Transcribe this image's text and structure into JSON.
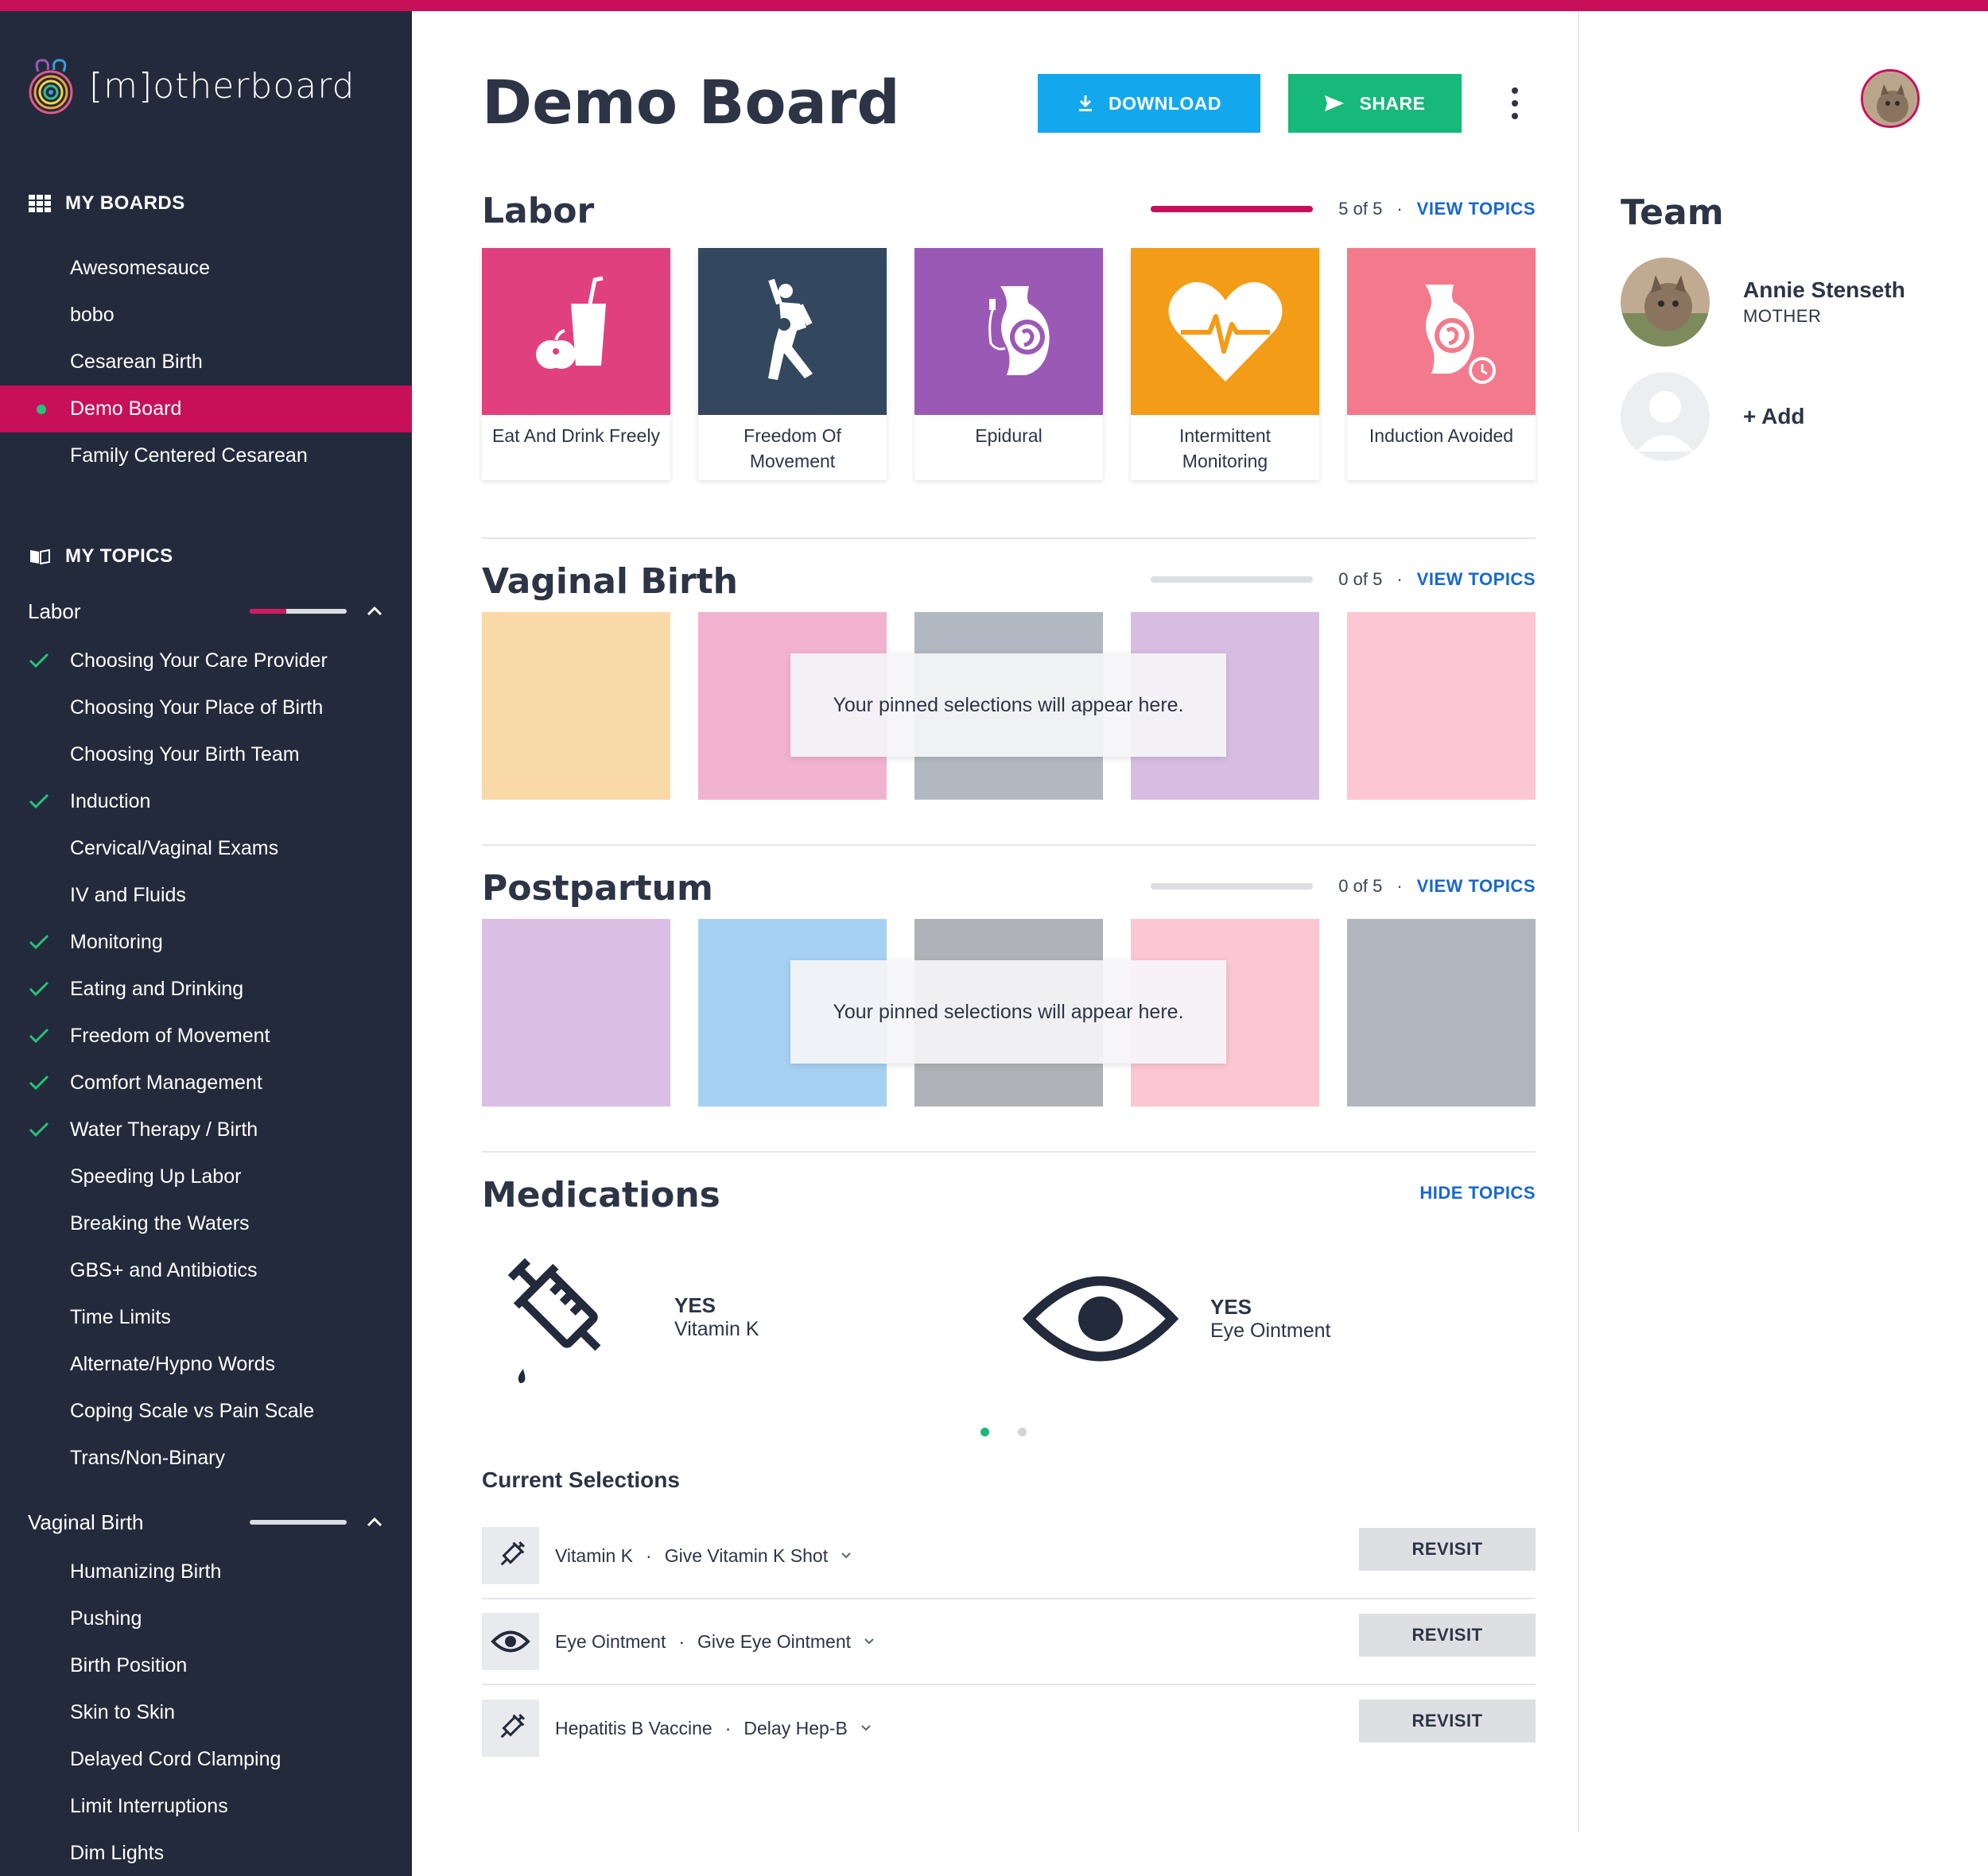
{
  "app": {
    "name": "[m]otherboard"
  },
  "sidebar": {
    "my_boards_label": "MY BOARDS",
    "boards": [
      {
        "label": "Awesomesauce",
        "active": false
      },
      {
        "label": "bobo",
        "active": false
      },
      {
        "label": "Cesarean Birth",
        "active": false
      },
      {
        "label": "Demo Board",
        "active": true
      },
      {
        "label": "Family Centered Cesarean",
        "active": false
      }
    ],
    "my_topics_label": "MY TOPICS",
    "groups": [
      {
        "label": "Labor",
        "progress": 0.38,
        "topics": [
          {
            "label": "Choosing Your Care Provider",
            "checked": true
          },
          {
            "label": "Choosing Your Place of Birth",
            "checked": false
          },
          {
            "label": "Choosing Your Birth Team",
            "checked": false
          },
          {
            "label": "Induction",
            "checked": true
          },
          {
            "label": "Cervical/Vaginal Exams",
            "checked": false
          },
          {
            "label": "IV and Fluids",
            "checked": false
          },
          {
            "label": "Monitoring",
            "checked": true
          },
          {
            "label": "Eating and Drinking",
            "checked": true
          },
          {
            "label": "Freedom of Movement",
            "checked": true
          },
          {
            "label": "Comfort Management",
            "checked": true
          },
          {
            "label": "Water Therapy / Birth",
            "checked": true
          },
          {
            "label": "Speeding Up Labor",
            "checked": false
          },
          {
            "label": "Breaking the Waters",
            "checked": false
          },
          {
            "label": "GBS+ and Antibiotics",
            "checked": false
          },
          {
            "label": "Time Limits",
            "checked": false
          },
          {
            "label": "Alternate/Hypno Words",
            "checked": false
          },
          {
            "label": "Coping Scale vs Pain Scale",
            "checked": false
          },
          {
            "label": "Trans/Non-Binary",
            "checked": false
          }
        ]
      },
      {
        "label": "Vaginal Birth",
        "progress": 0,
        "topics": [
          {
            "label": "Humanizing Birth",
            "checked": false
          },
          {
            "label": "Pushing",
            "checked": false
          },
          {
            "label": "Birth Position",
            "checked": false
          },
          {
            "label": "Skin to Skin",
            "checked": false
          },
          {
            "label": "Delayed Cord Clamping",
            "checked": false
          },
          {
            "label": "Limit Interruptions",
            "checked": false
          },
          {
            "label": "Dim Lights",
            "checked": false
          }
        ]
      }
    ]
  },
  "header": {
    "title": "Demo Board",
    "download_label": "DOWNLOAD",
    "share_label": "SHARE"
  },
  "sections": {
    "labor": {
      "title": "Labor",
      "count": "5 of 5",
      "progress": 1.0,
      "link": "VIEW TOPICS",
      "cards": [
        {
          "label": "Eat And Drink Freely",
          "color": "#e0407e",
          "icon": "drink-food-icon"
        },
        {
          "label": "Freedom Of Movement",
          "color": "#33475e",
          "icon": "movement-figure-icon"
        },
        {
          "label": "Epidural",
          "color": "#9b59b6",
          "icon": "epidural-icon"
        },
        {
          "label": "Intermittent Monitoring",
          "color": "#f39c17",
          "icon": "heart-monitor-icon"
        },
        {
          "label": "Induction Avoided",
          "color": "#f27a8c",
          "icon": "induction-clock-icon"
        }
      ]
    },
    "vaginal": {
      "title": "Vaginal Birth",
      "count": "0 of 5",
      "progress": 0,
      "link": "VIEW TOPICS",
      "placeholder": "Your pinned selections will appear here.",
      "colors": [
        "#f9d9a8",
        "#f2b3d0",
        "#b2b8c1",
        "#d8bde3",
        "#fcc7d2"
      ]
    },
    "postpartum": {
      "title": "Postpartum",
      "count": "0 of 5",
      "progress": 0,
      "link": "VIEW TOPICS",
      "placeholder": "Your pinned selections will appear here.",
      "colors": [
        "#d9bfe4",
        "#a6d1f2",
        "#b0b2b8",
        "#fcc7d0",
        "#b1b6bf"
      ]
    },
    "medications": {
      "title": "Medications",
      "link": "HIDE TOPICS",
      "items": [
        {
          "status": "YES",
          "name": "Vitamin K",
          "icon": "syringe-icon"
        },
        {
          "status": "YES",
          "name": "Eye Ointment",
          "icon": "eye-icon"
        }
      ],
      "current_selections_title": "Current Selections",
      "selections": [
        {
          "name": "Vitamin K",
          "choice": "Give Vitamin K Shot",
          "icon": "syringe-icon",
          "action": "REVISIT"
        },
        {
          "name": "Eye Ointment",
          "choice": "Give Eye Ointment",
          "icon": "eye-icon",
          "action": "REVISIT"
        },
        {
          "name": "Hepatitis B Vaccine",
          "choice": "Delay Hep-B",
          "icon": "syringe-icon",
          "action": "REVISIT"
        }
      ]
    }
  },
  "team": {
    "title": "Team",
    "members": [
      {
        "name": "Annie Stenseth",
        "role": "MOTHER"
      }
    ],
    "add_label": "+ Add"
  },
  "colors": {
    "accent": "#c8105a",
    "sidebar": "#232a3c",
    "link": "#1867d2",
    "download": "#13a8ee",
    "share": "#16b97a",
    "check": "#23c37a"
  }
}
